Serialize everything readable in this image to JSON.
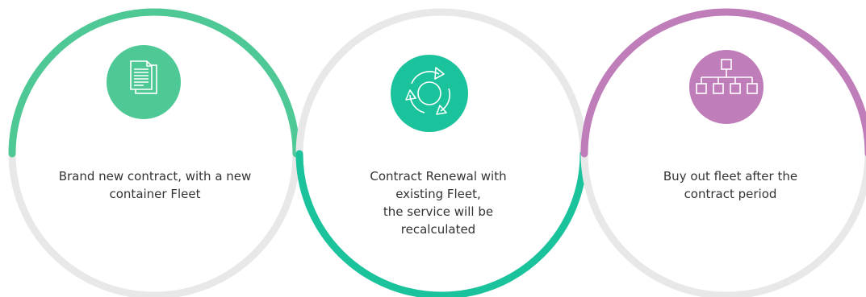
{
  "colors": {
    "ring_gray": "#e8e8e8",
    "green": "#4ec996",
    "teal": "#1bc39c",
    "purple": "#bf7dba",
    "icon_white": "#ffffff",
    "text": "#333333"
  },
  "steps": [
    {
      "icon": "document-icon",
      "lines": [
        "Brand new contract, with a new",
        "container Fleet"
      ]
    },
    {
      "icon": "recycle-arrows-icon",
      "lines": [
        "Contract Renewal with",
        "existing Fleet,",
        "the service will be",
        "recalculated"
      ]
    },
    {
      "icon": "org-chart-icon",
      "lines": [
        "Buy out fleet after the",
        "contract period"
      ]
    }
  ]
}
